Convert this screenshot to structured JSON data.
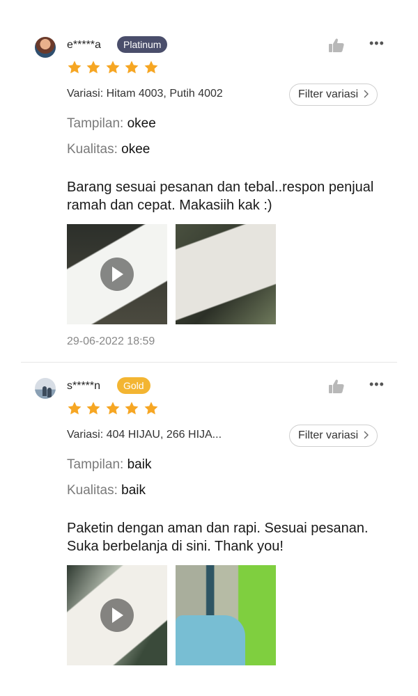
{
  "icons": {
    "like": "thumbs-up-icon",
    "more": "more-options-icon",
    "star": "star-icon",
    "play": "play-icon",
    "chevron": "chevron-right-icon"
  },
  "colors": {
    "star": "#f6a623",
    "badge_platinum": "#4a4e6b",
    "badge_gold": "#f3b532"
  },
  "reviews": [
    {
      "username": "e*****a",
      "badge": "Platinum",
      "rating": 5,
      "variation": "Variasi: Hitam 4003, Putih 4002",
      "filter_label": "Filter variasi",
      "appearance_label": "Tampilan:",
      "appearance_value": "okee",
      "quality_label": "Kualitas:",
      "quality_value": "okee",
      "text": "Barang sesuai pesanan dan tebal..respon penjual ramah dan cepat. Makasiih kak :)",
      "timestamp": "29-06-2022 18:59"
    },
    {
      "username": "s*****n",
      "badge": "Gold",
      "rating": 5,
      "variation": "Variasi: 404 HIJAU, 266 HIJA...",
      "filter_label": "Filter variasi",
      "appearance_label": "Tampilan:",
      "appearance_value": "baik",
      "quality_label": "Kualitas:",
      "quality_value": "baik",
      "text": "Paketin dengan aman dan rapi. Sesuai pesanan. Suka berbelanja di sini. Thank you!"
    }
  ]
}
